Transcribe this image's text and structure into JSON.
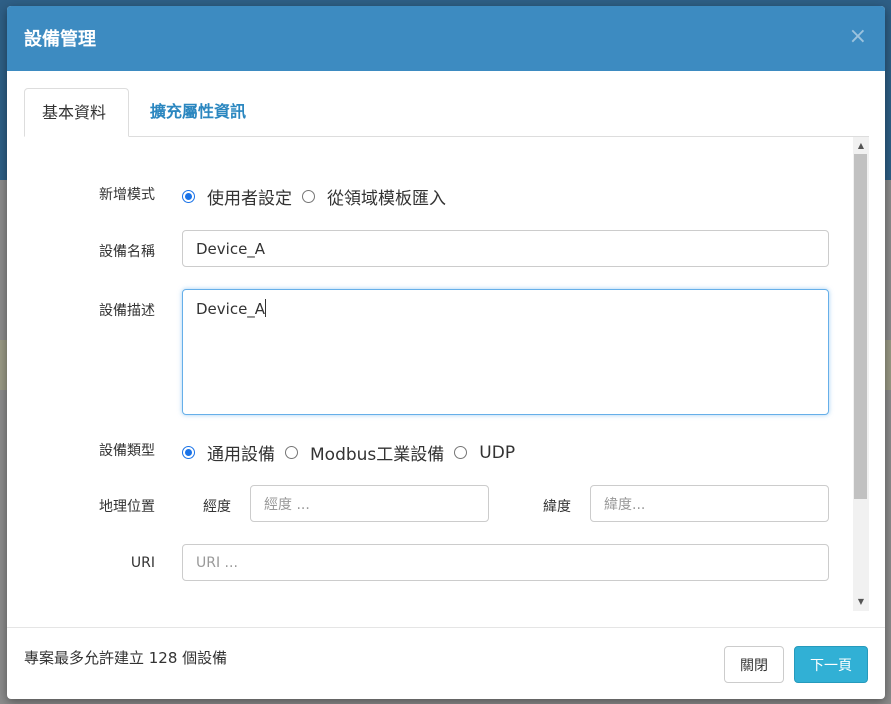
{
  "dialog": {
    "title": "設備管理",
    "close_glyph": "×"
  },
  "tabs": [
    {
      "label": "基本資料",
      "active": true
    },
    {
      "label": "擴充屬性資訊",
      "active": false
    }
  ],
  "form": {
    "add_mode": {
      "label": "新增模式",
      "options": [
        {
          "label": "使用者設定",
          "checked": true
        },
        {
          "label": "從領域模板匯入",
          "checked": false
        }
      ]
    },
    "device_name": {
      "label": "設備名稱",
      "value": "Device_A"
    },
    "device_desc": {
      "label": "設備描述",
      "value": "Device_A"
    },
    "device_type": {
      "label": "設備類型",
      "options": [
        {
          "label": "通用設備",
          "checked": true
        },
        {
          "label": "Modbus工業設備",
          "checked": false
        },
        {
          "label": "UDP",
          "checked": false
        }
      ]
    },
    "location": {
      "label": "地理位置",
      "longitude_label": "經度",
      "longitude_placeholder": "經度 ...",
      "latitude_label": "緯度",
      "latitude_placeholder": "緯度..."
    },
    "uri": {
      "label": "URI",
      "placeholder": "URI ..."
    }
  },
  "footer": {
    "note": "專案最多允許建立 128 個設備",
    "close_label": "關閉",
    "next_label": "下一頁"
  },
  "scrollbar": {
    "up_glyph": "▲",
    "down_glyph": "▼"
  },
  "colors": {
    "header_bg": "#3d8bc1",
    "tab_active_text": "#333333",
    "tab_inactive_text": "#2b87c0",
    "next_button_bg": "#31b0d5",
    "radio_checked": "#1a73e8"
  }
}
